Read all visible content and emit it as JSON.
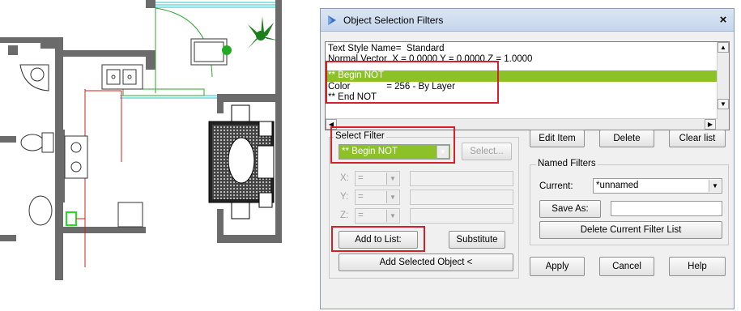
{
  "dialog": {
    "title": "Object Selection Filters",
    "close": "×",
    "filter_list": {
      "rows": [
        "Text Style Name=  Standard",
        "Normal Vector  X = 0.0000 Y = 0.0000 Z = 1.0000",
        "** Begin NOT",
        "Color              = 256 - By Layer",
        "** End NOT"
      ],
      "selected_row_index": 2
    },
    "select_filter": {
      "group_label": "Select Filter",
      "combo_value": "** Begin NOT",
      "select_button": "Select...",
      "x_label": "X:",
      "y_label": "Y:",
      "z_label": "Z:",
      "op_value": "=",
      "add_to_list": "Add to List:",
      "substitute": "Substitute",
      "add_selected_object": "Add Selected Object <"
    },
    "edit_buttons": {
      "edit_item": "Edit Item",
      "delete": "Delete",
      "clear_list": "Clear list"
    },
    "named_filters": {
      "group_label": "Named Filters",
      "current_label": "Current:",
      "current_value": "*unnamed",
      "save_as": "Save As:",
      "delete_current": "Delete Current Filter List"
    },
    "bottom_buttons": {
      "apply": "Apply",
      "cancel": "Cancel",
      "help": "Help"
    },
    "colors": {
      "selection_green": "#8cc228",
      "highlight_red": "#d3202a"
    }
  },
  "floor_plan": {
    "icons": [
      "plant-icon",
      "sink-icon",
      "stove-icon",
      "toilet-icon",
      "dining-table-icon",
      "sofa-icon"
    ]
  }
}
